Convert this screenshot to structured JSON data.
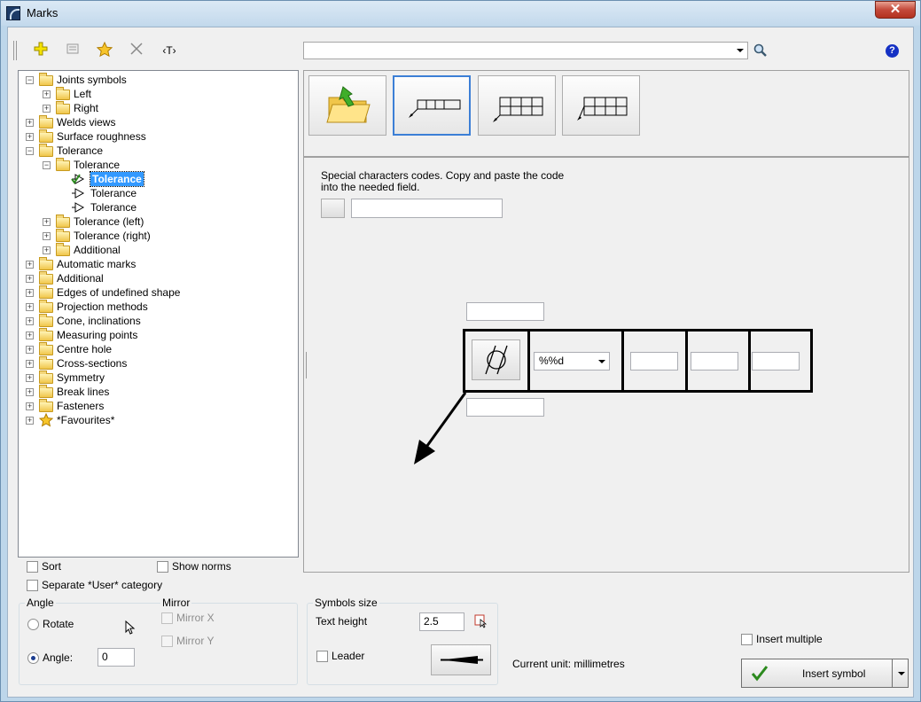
{
  "window": {
    "title": "Marks",
    "close_glyph": "✕"
  },
  "toolbar": {
    "icons": [
      "add-icon",
      "properties-icon",
      "favourite-icon",
      "delete-icon",
      "text-icon"
    ],
    "text_glyph": "‹T›",
    "search_value": ""
  },
  "tree": {
    "nodes": [
      {
        "label": "Joints symbols",
        "expanded": true
      },
      {
        "label": "Left"
      },
      {
        "label": "Right"
      },
      {
        "label": "Welds views"
      },
      {
        "label": "Surface roughness"
      },
      {
        "label": "Tolerance",
        "expanded": true
      },
      {
        "label": "Tolerance",
        "expanded": true
      },
      {
        "label": "Tolerance",
        "selected": true
      },
      {
        "label": "Tolerance"
      },
      {
        "label": "Tolerance"
      },
      {
        "label": "Tolerance (left)"
      },
      {
        "label": "Tolerance (right)"
      },
      {
        "label": "Additional"
      },
      {
        "label": "Automatic marks"
      },
      {
        "label": "Additional"
      },
      {
        "label": "Edges of undefined shape"
      },
      {
        "label": "Projection methods"
      },
      {
        "label": "Cone, inclinations"
      },
      {
        "label": "Measuring points"
      },
      {
        "label": "Centre hole"
      },
      {
        "label": "Cross-sections"
      },
      {
        "label": "Symmetry"
      },
      {
        "label": "Break lines"
      },
      {
        "label": "Fasteners"
      },
      {
        "label": "*Favourites*"
      }
    ]
  },
  "options": {
    "sort": "Sort",
    "show_norms": "Show norms",
    "separate_user": "Separate *User* category"
  },
  "angle": {
    "title": "Angle",
    "rotate": "Rotate",
    "angle_label": "Angle:",
    "angle_value": "0"
  },
  "mirror": {
    "title": "Mirror",
    "mirror_x": "Mirror X",
    "mirror_y": "Mirror Y"
  },
  "symbols_size": {
    "title": "Symbols size",
    "text_height_label": "Text height",
    "text_height_value": "2.5",
    "leader_label": "Leader"
  },
  "special_chars": {
    "note": "Special characters codes. Copy and paste the code into the needed field.",
    "code_value": ""
  },
  "frame": {
    "dropdown_value": "%%d"
  },
  "current_unit": "Current unit: millimetres",
  "insert_multiple": "Insert multiple",
  "insert_button": "Insert symbol",
  "colors": {
    "accent": "#3c7fd6",
    "selection": "#3399ff",
    "check_green": "#2c8a1e"
  }
}
